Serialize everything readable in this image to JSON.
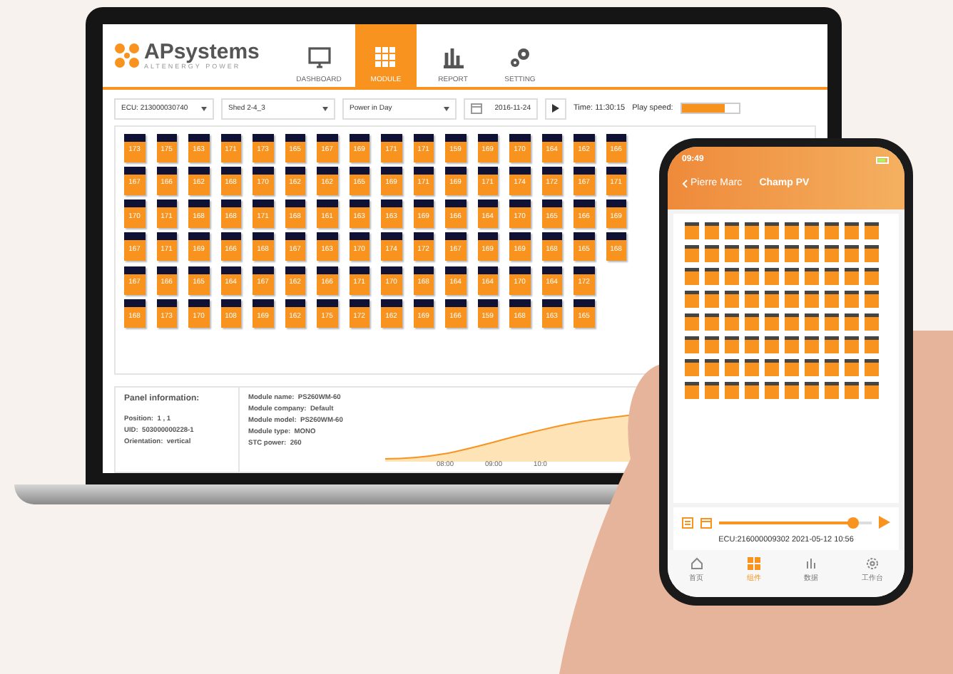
{
  "laptop": {
    "logo": {
      "name": "APsystems",
      "tagline": "ALTENERGY POWER"
    },
    "nav": [
      {
        "label": "DASHBOARD",
        "kind": "monitor",
        "selected": false
      },
      {
        "label": "MODULE",
        "kind": "grid",
        "selected": true
      },
      {
        "label": "REPORT",
        "kind": "bars",
        "selected": false
      },
      {
        "label": "SETTING",
        "kind": "gears",
        "selected": false
      }
    ],
    "toolbar": {
      "ecu_select": "ECU: 213000030740",
      "shed_select": "Shed 2-4_3",
      "mode_select": "Power in Day",
      "date": "2016-11-24",
      "time": "Time: 11:30:15",
      "speed_label": "Play speed:",
      "speed": {
        "level": 0.75
      }
    },
    "modules": [
      [
        "173",
        "175",
        "163",
        "171",
        "173",
        "165",
        "167",
        "169",
        "171",
        "171",
        "159",
        "169",
        "170",
        "164",
        "162",
        "166"
      ],
      [
        "167",
        "166",
        "162",
        "168",
        "170",
        "162",
        "162",
        "165",
        "169",
        "171",
        "169",
        "171",
        "174",
        "172",
        "167",
        "171"
      ],
      [
        "170",
        "171",
        "168",
        "168",
        "171",
        "168",
        "161",
        "163",
        "163",
        "169",
        "166",
        "164",
        "170",
        "165",
        "166",
        "169"
      ],
      [
        "167",
        "171",
        "169",
        "166",
        "168",
        "167",
        "163",
        "170",
        "174",
        "172",
        "167",
        "169",
        "169",
        "168",
        "165",
        "168"
      ],
      [
        "167",
        "166",
        "165",
        "164",
        "167",
        "162",
        "166",
        "171",
        "170",
        "168",
        "164",
        "164",
        "170",
        "164",
        "172"
      ],
      [
        "168",
        "173",
        "170",
        "108",
        "169",
        "162",
        "175",
        "172",
        "162",
        "169",
        "166",
        "159",
        "168",
        "163",
        "165"
      ]
    ],
    "panel_info": {
      "title": "Panel information:",
      "left": [
        {
          "label": "Position:",
          "value": "1 , 1"
        },
        {
          "label": "UID:",
          "value": "503000000228-1"
        },
        {
          "label": "Orientation:",
          "value": "vertical"
        }
      ],
      "right": [
        {
          "label": "Module name:",
          "value": "PS260WM-60"
        },
        {
          "label": "Module company:",
          "value": "Default"
        },
        {
          "label": "Module model:",
          "value": "PS260WM-60"
        },
        {
          "label": "Module type:",
          "value": "MONO"
        },
        {
          "label": "STC power:",
          "value": "260"
        }
      ]
    },
    "chart_ticks": [
      "08:00",
      "09:00",
      "10:0"
    ]
  },
  "phone": {
    "status_time": "09:49",
    "back_label": "Pierre Marc",
    "title": "Champ PV",
    "playback": {
      "level": 0.88
    },
    "ecu_line": "ECU:216000009302 2021-05-12 10:56",
    "tabs": [
      {
        "label": "首页",
        "kind": "home",
        "selected": false
      },
      {
        "label": "组件",
        "kind": "grid",
        "selected": true
      },
      {
        "label": "数据",
        "kind": "bars",
        "selected": false
      },
      {
        "label": "工作台",
        "kind": "gear",
        "selected": false
      }
    ]
  }
}
